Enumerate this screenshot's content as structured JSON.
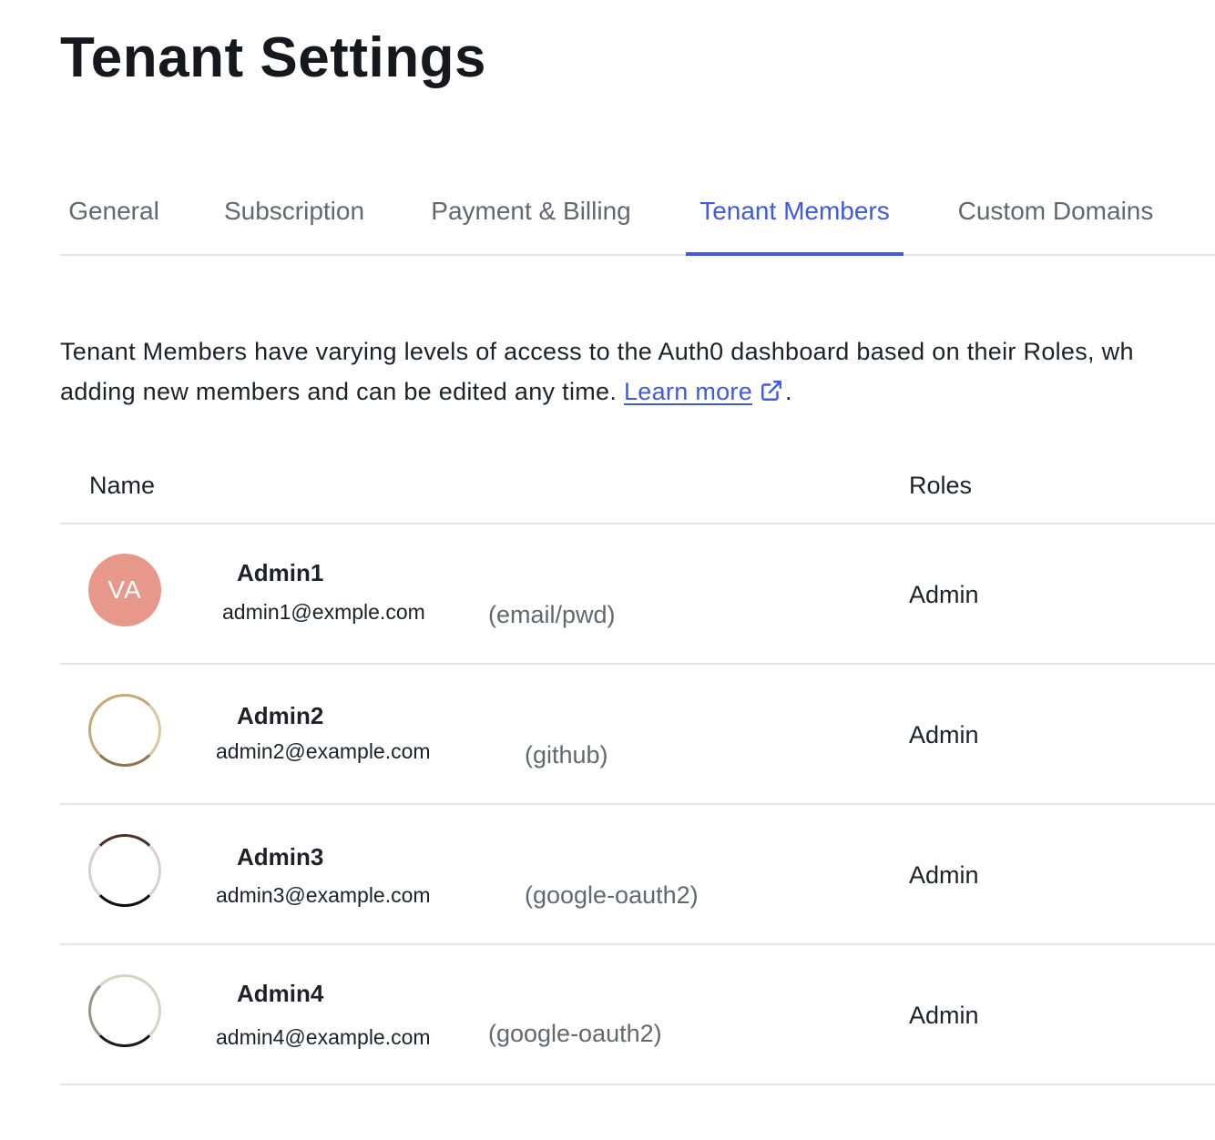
{
  "page": {
    "title": "Tenant Settings"
  },
  "tabs": [
    {
      "label": "General",
      "active": false
    },
    {
      "label": "Subscription",
      "active": false
    },
    {
      "label": "Payment & Billing",
      "active": false
    },
    {
      "label": "Tenant Members",
      "active": true
    },
    {
      "label": "Custom Domains",
      "active": false
    }
  ],
  "description": {
    "line1": "Tenant Members have varying levels of access to the Auth0 dashboard based on their Roles, wh",
    "line2_prefix": "adding new members and can be edited any time. ",
    "link_text": "Learn more",
    "suffix": "."
  },
  "table": {
    "headers": {
      "name": "Name",
      "roles": "Roles"
    },
    "rows": [
      {
        "initials": "VA",
        "name": "Admin1",
        "email": "admin1@exmple.com",
        "connection": "(email/pwd)",
        "role": "Admin"
      },
      {
        "initials": "",
        "name": "Admin2",
        "email": "admin2@example.com",
        "connection": "(github)",
        "role": "Admin"
      },
      {
        "initials": "",
        "name": "Admin3",
        "email": "admin3@example.com",
        "connection": "(google-oauth2)",
        "role": "Admin"
      },
      {
        "initials": "",
        "name": "Admin4",
        "email": "admin4@example.com",
        "connection": "(google-oauth2)",
        "role": "Admin"
      }
    ]
  },
  "colors": {
    "accent": "#3f59e4",
    "avatar_initials_bg": "#e8988a",
    "muted_text": "#65676e",
    "divider": "#e3e5e8"
  },
  "icons": {
    "learn_more": "external-link-icon"
  }
}
